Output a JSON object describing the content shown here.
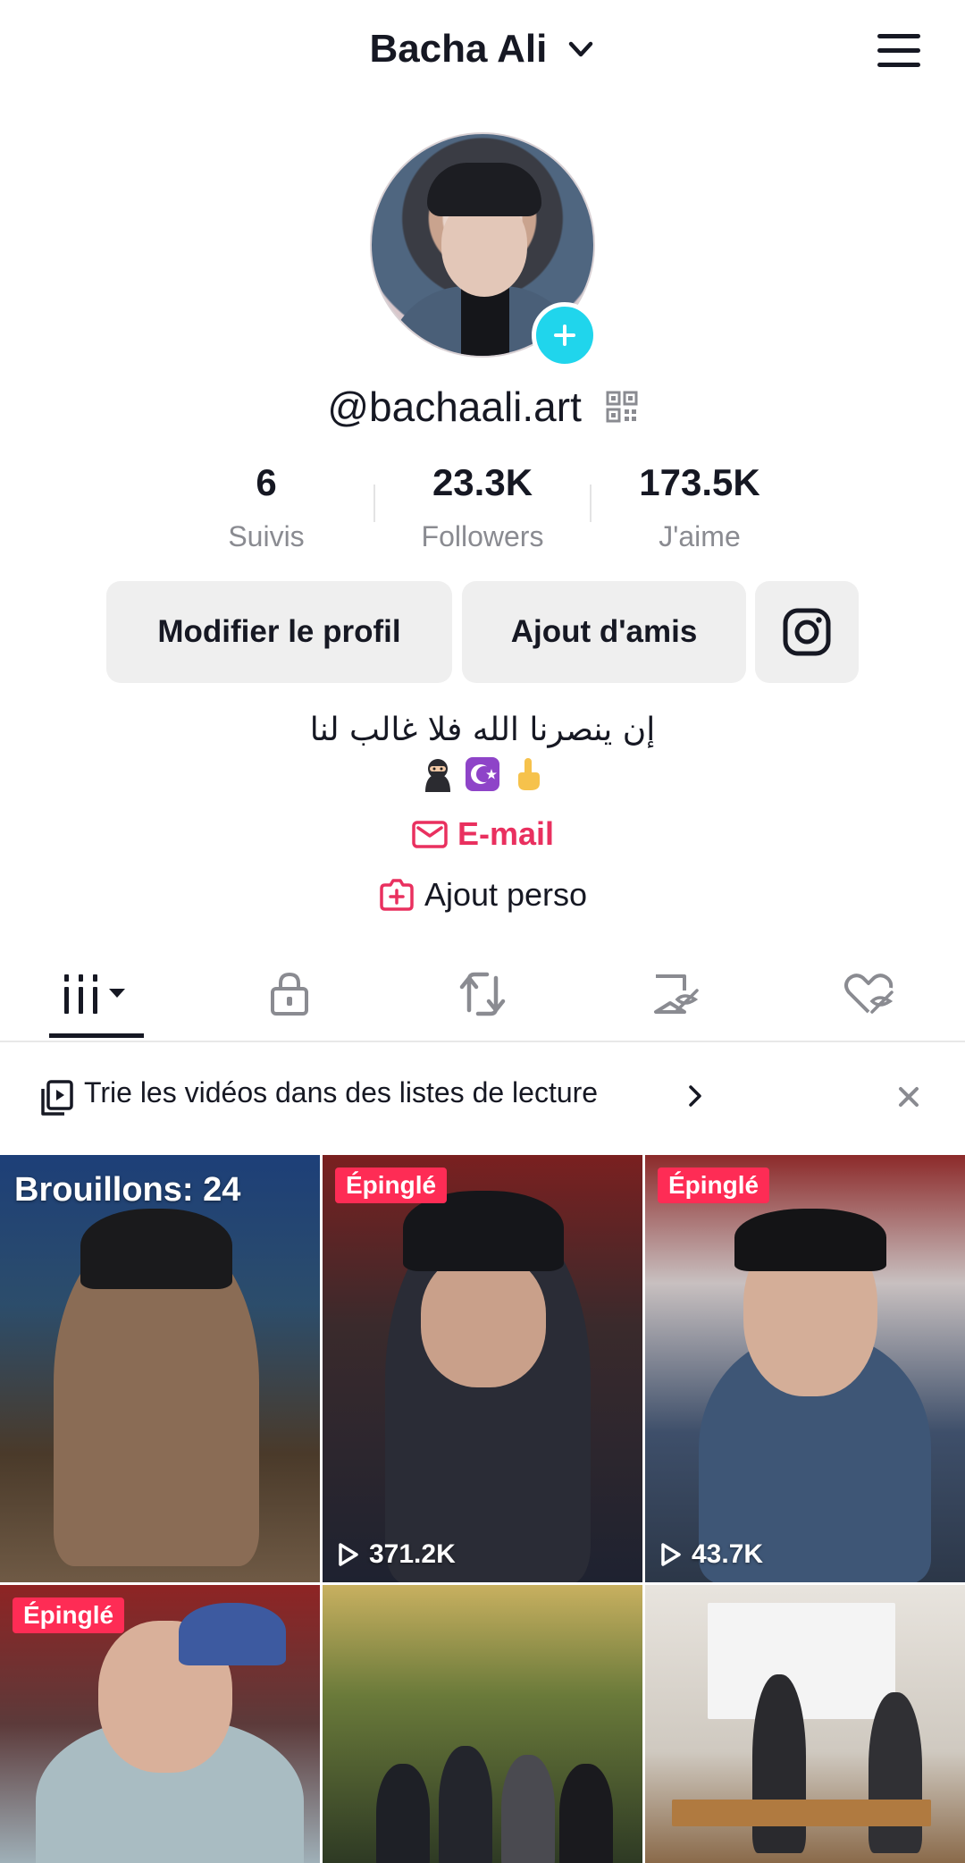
{
  "header": {
    "title": "Bacha Ali",
    "icons": {
      "dropdown": "chevron-down-icon",
      "menu": "hamburger-menu-icon"
    }
  },
  "profile": {
    "username": "@bachaali.art",
    "stats": [
      {
        "value": "6",
        "label": "Suivis"
      },
      {
        "value": "23.3K",
        "label": "Followers"
      },
      {
        "value": "173.5K",
        "label": "J'aime"
      }
    ]
  },
  "actions": {
    "edit_profile": "Modifier le profil",
    "add_friends": "Ajout d'amis",
    "instagram_icon": "instagram-icon"
  },
  "bio": {
    "line1": "إن ينصرنا الله فلا غالب لنا",
    "emojis": [
      "ninja",
      "star-and-crescent",
      "index-pointing-up"
    ],
    "email_label": "E-mail",
    "add_perso_label": "Ajout perso"
  },
  "tabs": [
    "videos-grid-icon",
    "lock-icon",
    "repost-icon",
    "favorites-icon",
    "liked-icon"
  ],
  "banner": {
    "text": "Trie les vidéos dans des listes de lecture",
    "icons": [
      "playlist-icon",
      "chevron-right-icon",
      "close-icon"
    ]
  },
  "videos": [
    {
      "type": "drafts",
      "label": "Brouillons: 24"
    },
    {
      "type": "pinned",
      "badge": "Épinglé",
      "views": "371.2K"
    },
    {
      "type": "pinned",
      "badge": "Épinglé",
      "views": "43.7K"
    },
    {
      "type": "pinned",
      "badge": "Épinglé"
    },
    {
      "type": "video"
    },
    {
      "type": "video"
    }
  ],
  "colors": {
    "accent_pink": "#fe2c55",
    "email_red": "#e9305f",
    "badge_cyan": "#20d5ec",
    "button_grey": "#efefef"
  }
}
